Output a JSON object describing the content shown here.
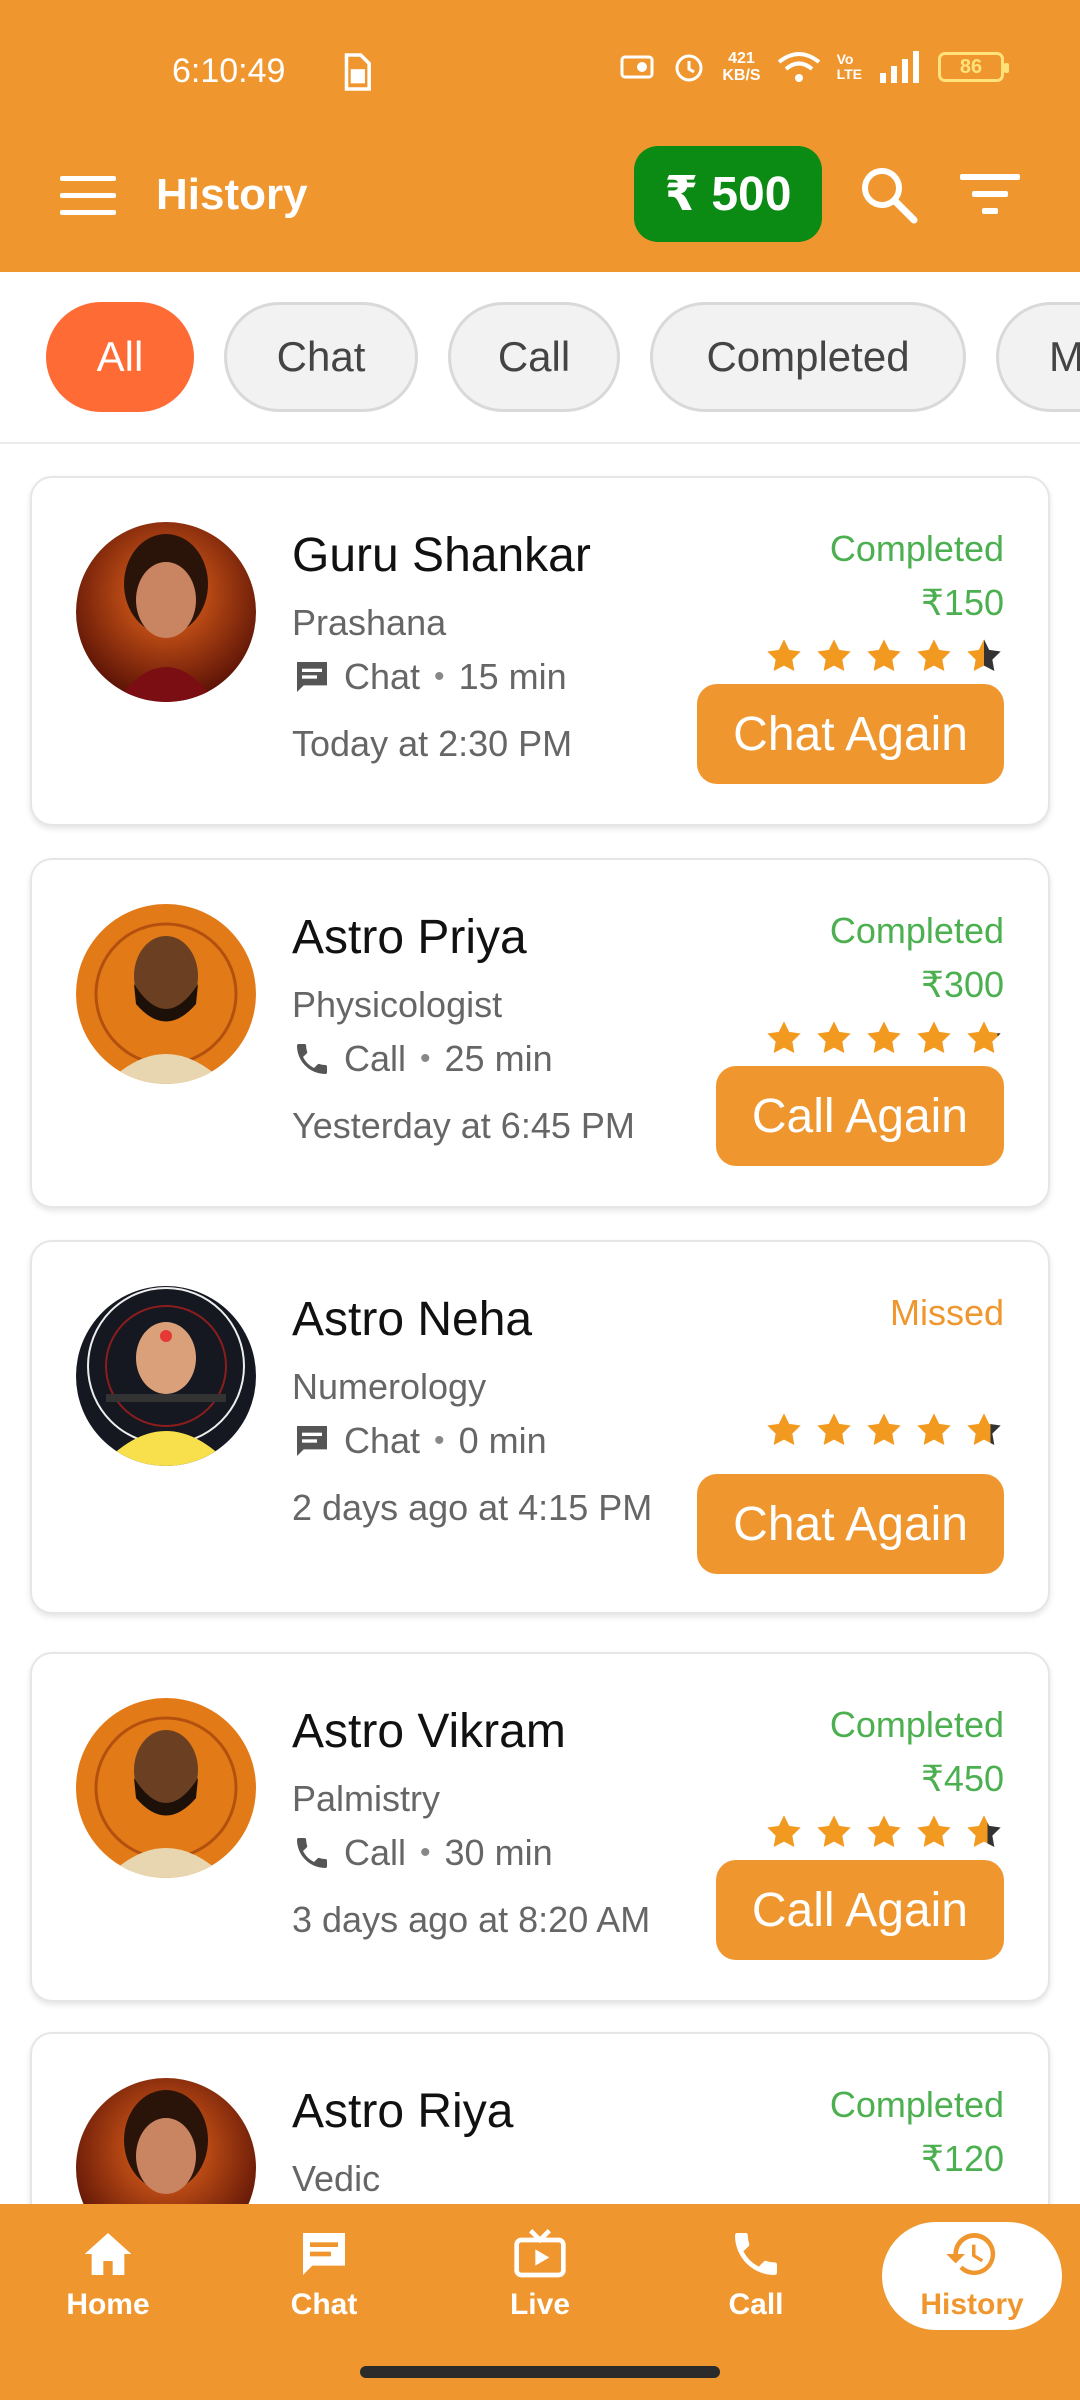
{
  "status_bar": {
    "time": "6:10:49",
    "speed_value": "421",
    "speed_unit": "KB/S",
    "vo": "Vo",
    "lte": "LTE",
    "battery": "86"
  },
  "header": {
    "title": "History",
    "wallet": "₹ 500"
  },
  "colors": {
    "primary": "#F0962E",
    "wallet_green": "#0B8A14",
    "chip_active": "#FF6B35",
    "completed_green": "#4CAF50"
  },
  "filters": [
    "All",
    "Chat",
    "Call",
    "Completed",
    "M"
  ],
  "active_filter": "All",
  "history": [
    {
      "name": "Guru Shankar",
      "specialty": "Prashana",
      "type": "Chat",
      "duration": "15 min",
      "when": "Today at 2:30 PM",
      "status": "Completed",
      "price": "₹150",
      "rating": 4.5,
      "action": "Chat Again"
    },
    {
      "name": "Astro Priya",
      "specialty": "Physicologist",
      "type": "Call",
      "duration": "25 min",
      "when": "Yesterday at 6:45 PM",
      "status": "Completed",
      "price": "₹300",
      "rating": 4.9,
      "action": "Call Again"
    },
    {
      "name": "Astro Neha",
      "specialty": "Numerology",
      "type": "Chat",
      "duration": "0 min",
      "when": "2 days ago at 4:15 PM",
      "status": "Missed",
      "price": "",
      "rating": 4.7,
      "action": "Chat Again"
    },
    {
      "name": "Astro Vikram",
      "specialty": "Palmistry",
      "type": "Call",
      "duration": "30 min",
      "when": "3 days ago at 8:20 AM",
      "status": "Completed",
      "price": "₹450",
      "rating": 4.6,
      "action": "Call Again"
    },
    {
      "name": "Astro Riya",
      "specialty": "Vedic",
      "type": "",
      "duration": "",
      "when": "",
      "status": "Completed",
      "price": "₹120",
      "rating": 0,
      "action": ""
    }
  ],
  "bottom_nav": [
    {
      "label": "Home",
      "icon": "home-icon"
    },
    {
      "label": "Chat",
      "icon": "chat-icon"
    },
    {
      "label": "Live",
      "icon": "live-tv-icon"
    },
    {
      "label": "Call",
      "icon": "phone-icon"
    },
    {
      "label": "History",
      "icon": "history-icon"
    }
  ]
}
